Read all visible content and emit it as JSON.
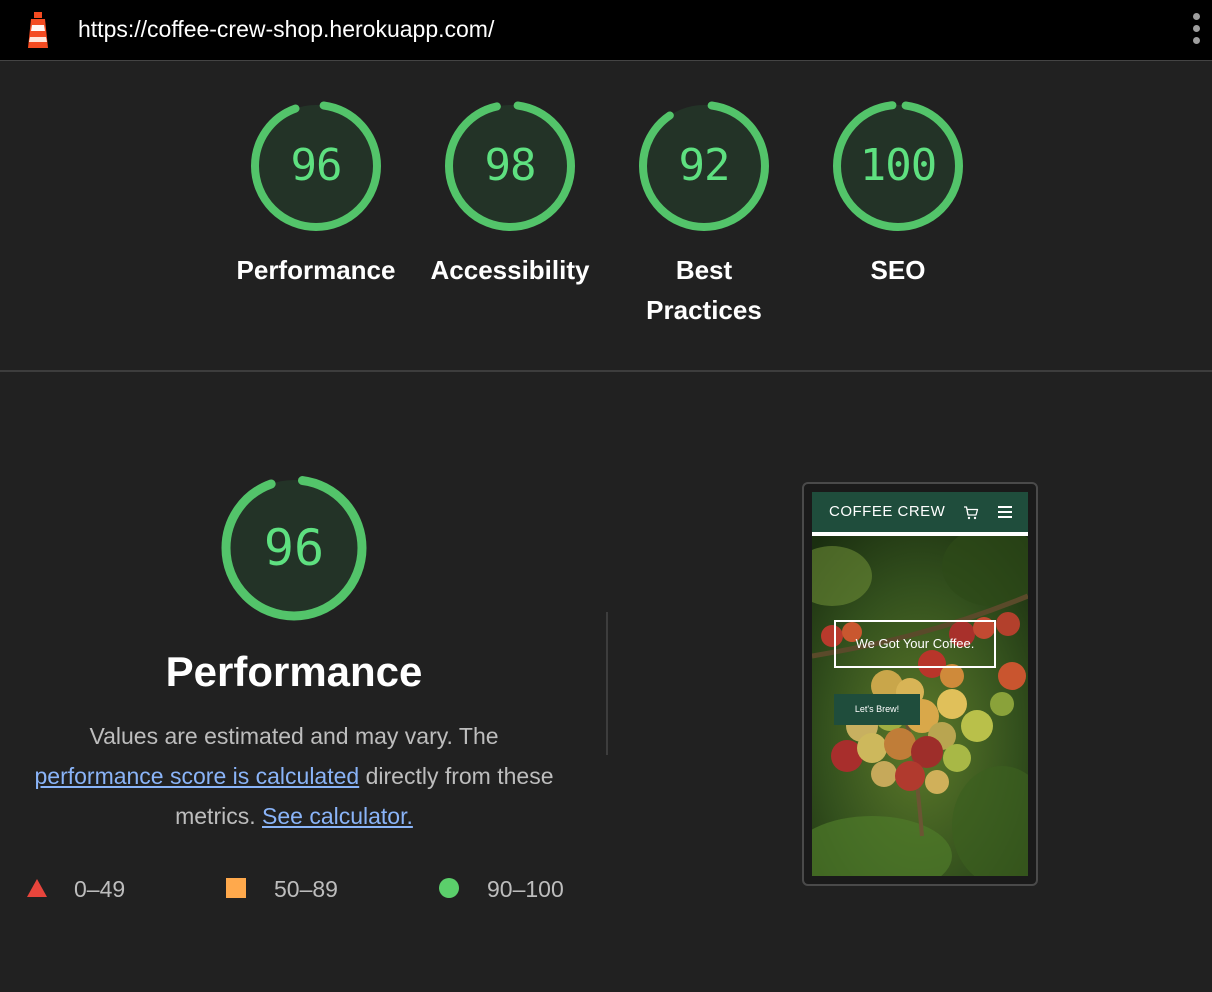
{
  "topbar": {
    "url": "https://coffee-crew-shop.herokuapp.com/",
    "logo_icon": "lighthouse-icon",
    "menu_icon": "kebab-menu-icon"
  },
  "scores": [
    {
      "label_line1": "Performance",
      "label_line2": "",
      "value": "96",
      "percent": 96
    },
    {
      "label_line1": "Accessibility",
      "label_line2": "",
      "value": "98",
      "percent": 98
    },
    {
      "label_line1": "Best",
      "label_line2": "Practices",
      "value": "92",
      "percent": 92
    },
    {
      "label_line1": "SEO",
      "label_line2": "",
      "value": "100",
      "percent": 100
    }
  ],
  "performance": {
    "score": "96",
    "percent": 96,
    "title": "Performance",
    "desc_text_1": "Values are estimated and may vary. The ",
    "desc_link_1": "performance score is calculated",
    "desc_text_2": " directly from these metrics. ",
    "desc_link_2": "See calculator."
  },
  "legend": [
    {
      "range": "0–49",
      "shape": "triangle",
      "color": "#e8453c"
    },
    {
      "range": "50–89",
      "shape": "square",
      "color": "#ffa94c"
    },
    {
      "range": "90–100",
      "shape": "circle",
      "color": "#5bcf6b"
    }
  ],
  "screenshot": {
    "brand": "COFFEE CREW",
    "hero_heading": "We Got Your Coffee.",
    "hero_button": "Let's Brew!",
    "cart_icon": "cart-icon",
    "menu_icon": "hamburger-menu-icon"
  },
  "colors": {
    "pass": "#5ee080",
    "pass_ring": "#53c46a",
    "background": "#212121",
    "link": "#8ab4f8"
  }
}
